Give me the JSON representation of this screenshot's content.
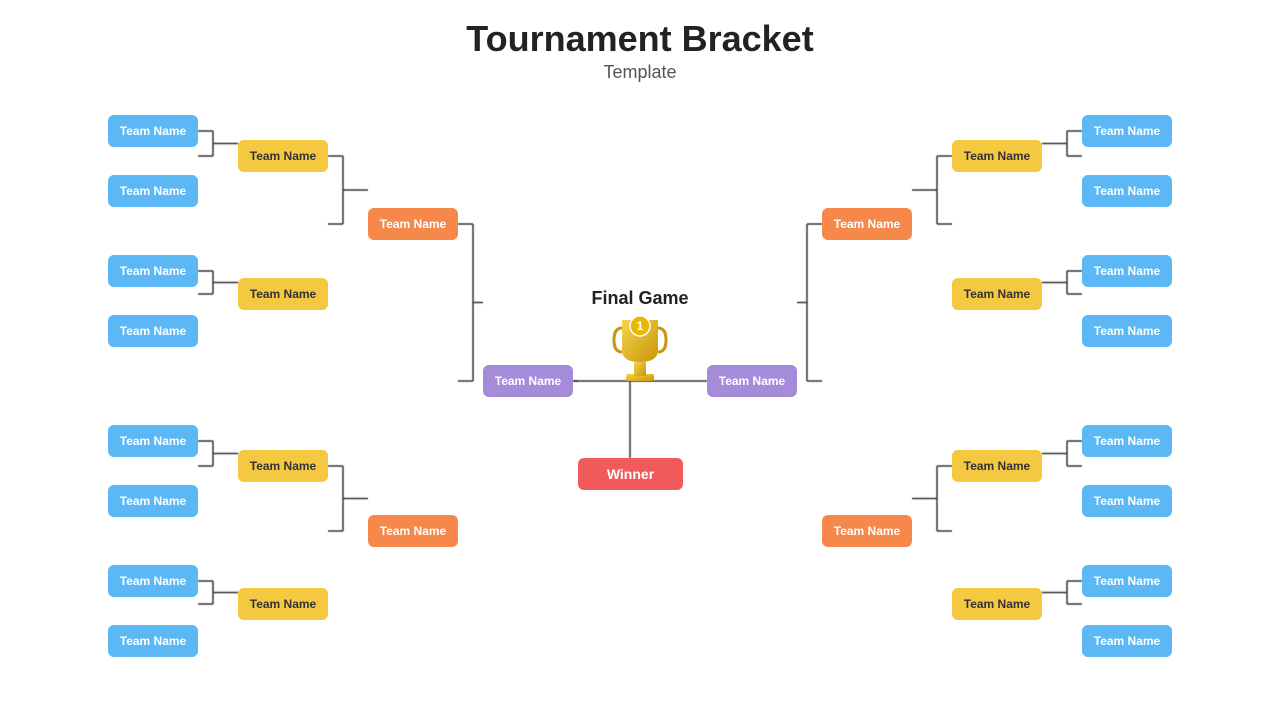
{
  "header": {
    "title": "Tournament Bracket",
    "subtitle": "Template"
  },
  "final_game_label": "Final Game",
  "winner_label": "Winner",
  "colors": {
    "blue": "#5bb8f5",
    "yellow": "#f5c842",
    "orange": "#f5884a",
    "purple": "#a78bdb",
    "red": "#f05a5a"
  },
  "teams": {
    "left_r1": [
      "Team Name",
      "Team Name",
      "Team Name",
      "Team Name",
      "Team Name",
      "Team Name",
      "Team Name",
      "Team Name"
    ],
    "left_r2": [
      "Team Name",
      "Team Name",
      "Team Name",
      "Team Name"
    ],
    "left_r3": [
      "Team Name",
      "Team Name"
    ],
    "left_r4": [
      "Team Name"
    ],
    "right_r1": [
      "Team Name",
      "Team Name",
      "Team Name",
      "Team Name",
      "Team Name",
      "Team Name",
      "Team Name",
      "Team Name"
    ],
    "right_r2": [
      "Team Name",
      "Team Name",
      "Team Name",
      "Team Name"
    ],
    "right_r3": [
      "Team Name",
      "Team Name"
    ],
    "right_r4": [
      "Team Name"
    ],
    "final_left": "Team Name",
    "final_right": "Team Name",
    "winner": "Winner"
  }
}
